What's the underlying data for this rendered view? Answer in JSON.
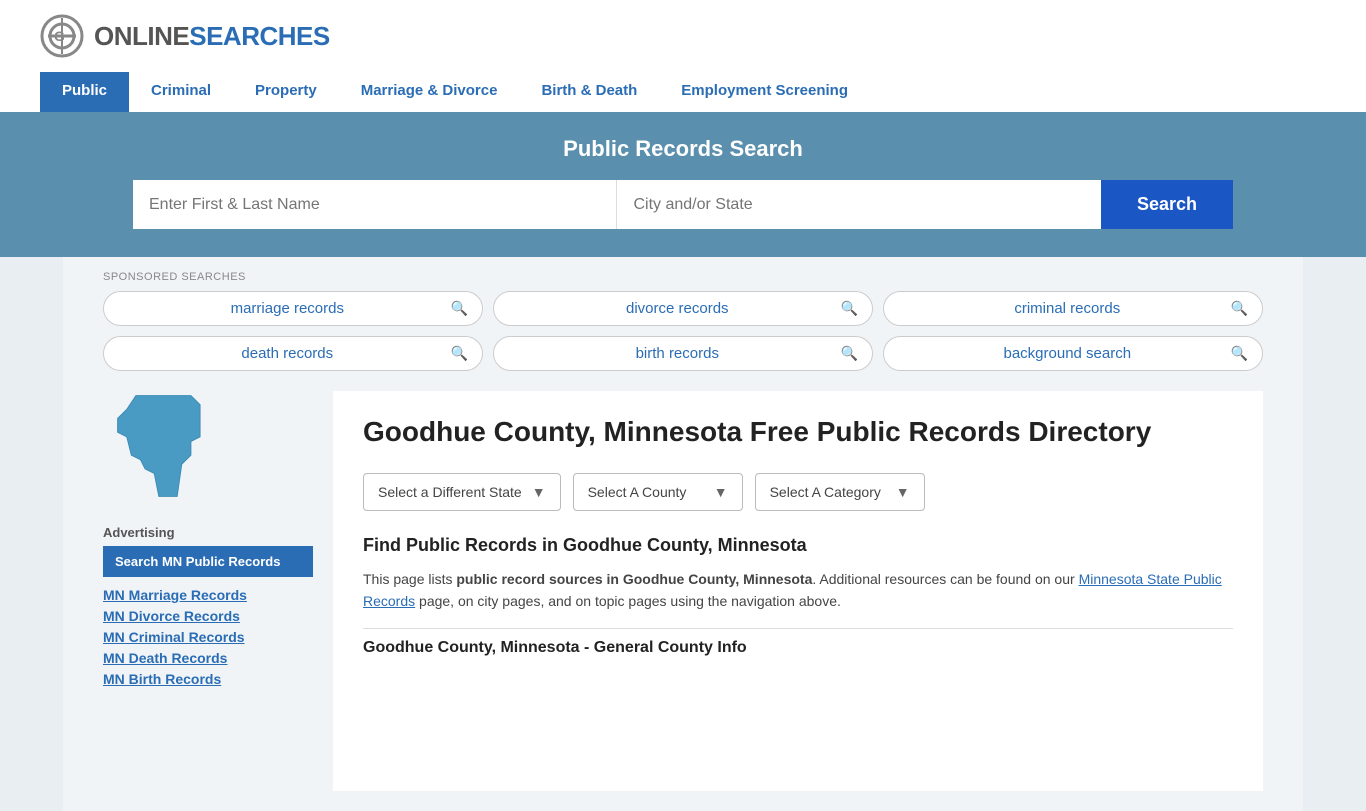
{
  "header": {
    "logo_online": "ONLINE",
    "logo_searches": "SEARCHES",
    "nav_items": [
      {
        "label": "Public",
        "active": true
      },
      {
        "label": "Criminal",
        "active": false
      },
      {
        "label": "Property",
        "active": false
      },
      {
        "label": "Marriage & Divorce",
        "active": false
      },
      {
        "label": "Birth & Death",
        "active": false
      },
      {
        "label": "Employment Screening",
        "active": false
      }
    ]
  },
  "search_banner": {
    "title": "Public Records Search",
    "name_placeholder": "Enter First & Last Name",
    "location_placeholder": "City and/or State",
    "search_button": "Search"
  },
  "sponsored": {
    "label": "SPONSORED SEARCHES",
    "items": [
      {
        "text": "marriage records"
      },
      {
        "text": "divorce records"
      },
      {
        "text": "criminal records"
      },
      {
        "text": "death records"
      },
      {
        "text": "birth records"
      },
      {
        "text": "background search"
      }
    ]
  },
  "sidebar": {
    "advertising_label": "Advertising",
    "ad_button": "Search MN Public Records",
    "links": [
      {
        "text": "MN Marriage Records"
      },
      {
        "text": "MN Divorce Records"
      },
      {
        "text": "MN Criminal Records"
      },
      {
        "text": "MN Death Records"
      },
      {
        "text": "MN Birth Records"
      }
    ]
  },
  "main": {
    "page_title": "Goodhue County, Minnesota Free Public Records Directory",
    "dropdowns": {
      "state": "Select a Different State",
      "county": "Select A County",
      "category": "Select A Category"
    },
    "find_title": "Find Public Records in Goodhue County, Minnesota",
    "find_desc_1": "This page lists ",
    "find_desc_bold": "public record sources in Goodhue County, Minnesota",
    "find_desc_2": ". Additional resources can be found on our ",
    "find_link": "Minnesota State Public Records",
    "find_desc_3": " page, on city pages, and on topic pages using the navigation above.",
    "section_subtitle": "Goodhue County, Minnesota - General County Info"
  }
}
